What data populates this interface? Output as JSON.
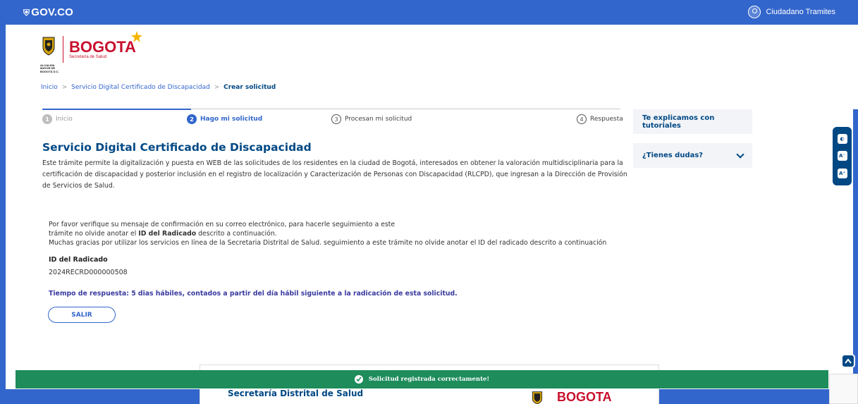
{
  "govbar": {
    "logo_text": "GOV.CO",
    "user_name": "Ciudadano Tramites",
    "bg_color": "#3366cc"
  },
  "brand": {
    "bogota": "BOGOTA",
    "sub": "Secretaría de Salud",
    "alcaldia": "ALCALDÍA MAYOR DE BOGOTÁ D.C."
  },
  "breadcrumb": {
    "items": [
      "Inicio",
      "Servicio Digital Certificado de Discapacidad"
    ],
    "current": "Crear solicitud",
    "separator": ">"
  },
  "stepper": {
    "steps": [
      {
        "num": "1",
        "label": "Inicio",
        "state": "done"
      },
      {
        "num": "2",
        "label": "Hago mi solicitud",
        "state": "active"
      },
      {
        "num": "3",
        "label": "Procesan mi solicitud",
        "state": "pending"
      },
      {
        "num": "4",
        "label": "Respuesta",
        "state": "pending"
      }
    ]
  },
  "main": {
    "title": "Servicio Digital Certificado de Discapacidad",
    "intro": "Este trámite permite la digitalización y puesta en WEB de las solicitudes de los residentes en la ciudad de Bogotá, interesados en obtener la valoración multidisciplinaria para la certificación de discapacidad y posterior inclusión en el registro de localización y Caracterización de Personas con Discapacidad (RLCPD), que ingresan a la Dirección de Provisión de Servicios de Salud.",
    "confirm_line1": "Por favor verifique su mensaje de confirmación en su correo electrónico, para hacerle seguimiento a este",
    "confirm_line2_pre": "trámite no olvide anotar el ",
    "confirm_line2_bold": "ID del Radicado",
    "confirm_line2_post": " descrito a continuación.",
    "confirm_line3": "Muchas gracias por utilizar los servicios en línea de la Secretaria Distrital de Salud. seguimiento a este trámite no olvide anotar el ID del radicado descrito a continuación",
    "id_label": "ID del Radicado",
    "id_value": "2024RECRD000000508",
    "response_time": "Tiempo de respuesta: 5 dias hábiles, contados a partir del día hábil siguiente a la radicación de esta solicitud.",
    "salir_label": "SALIR"
  },
  "sidebar": {
    "tutorials": "Te explicamos con tutoriales",
    "dudas": "¿Tienes dudas?"
  },
  "accessibility": {
    "buttons": [
      "◐",
      "A⁻",
      "A⁺"
    ]
  },
  "footer": {
    "title": "Secretaría Distrital de Salud",
    "bogota": "BOGOTA"
  },
  "toast": {
    "message": "Solicitud registrada correctamente!",
    "color": "#1e8c5b"
  }
}
